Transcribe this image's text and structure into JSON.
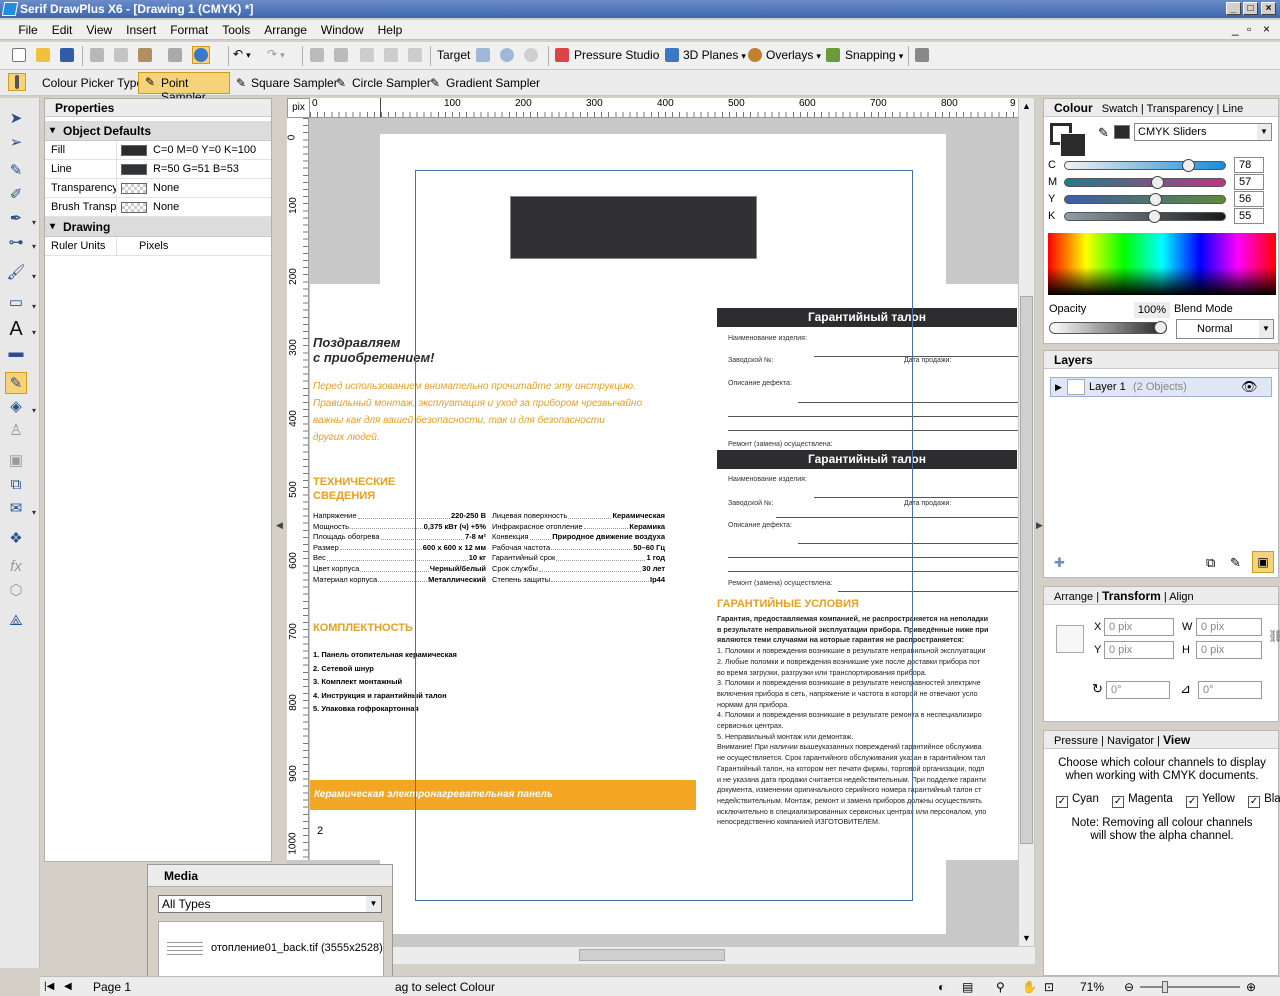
{
  "window": {
    "title": "Serif DrawPlus X6 - [Drawing 1 (CMYK) *]"
  },
  "menu": [
    "File",
    "Edit",
    "View",
    "Insert",
    "Format",
    "Tools",
    "Arrange",
    "Window",
    "Help"
  ],
  "toolbar": {
    "target": "Target",
    "pressure_studio": "Pressure Studio",
    "planes_3d": "3D Planes",
    "overlays": "Overlays",
    "snapping": "Snapping"
  },
  "context": {
    "label": "Colour Picker Type:",
    "point": "Point Sampler",
    "square": "Square Sampler",
    "circle": "Circle Sampler",
    "gradient": "Gradient Sampler"
  },
  "properties": {
    "title": "Properties",
    "object_defaults": "Object Defaults",
    "rows": [
      {
        "k": "Fill",
        "v": "C=0 M=0 Y=0 K=100",
        "swatch": "#2b2b2b"
      },
      {
        "k": "Line",
        "v": "R=50 G=51 B=53",
        "swatch": "#323335"
      },
      {
        "k": "Transparency",
        "v": "None",
        "swatch": "checker"
      },
      {
        "k": "Brush Transparency",
        "v": "None",
        "swatch": "checker"
      }
    ],
    "drawing": "Drawing",
    "ruler": {
      "k": "Ruler Units",
      "v": "Pixels"
    }
  },
  "rulers": {
    "unit": "pix",
    "h": [
      "0",
      "100",
      "200",
      "300",
      "400",
      "500",
      "600",
      "700",
      "800",
      "9"
    ],
    "v": [
      "0",
      "100",
      "200",
      "300",
      "400",
      "500",
      "600",
      "700",
      "800",
      "900",
      "1000"
    ]
  },
  "doc": {
    "page_number": "2",
    "congrats1": "Поздравляем",
    "congrats2": "с приобретением!",
    "intro": [
      "Перед использованием внимательно прочитайте эту инструкцию.",
      "Правильный монтаж, эксплуатация и уход за прибором чрезвычайно",
      "важны как для вашей безопасности, так и для безопасности",
      "других людей."
    ],
    "tech_title1": "ТЕХНИЧЕСКИЕ",
    "tech_title2": "СВЕДЕНИЯ",
    "specs_left": [
      [
        "Напряжение",
        "220-250 В"
      ],
      [
        "Мощность",
        "0,375 кВт (ч) +5%"
      ],
      [
        "Площадь обогрева",
        "7-8 м²"
      ],
      [
        "Размер",
        "600 х 600 х 12 мм"
      ],
      [
        "Вес",
        "10 кг"
      ],
      [
        "Цвет корпуса",
        "Черный/белый"
      ],
      [
        "Материал корпуса",
        "Металлический"
      ]
    ],
    "specs_right": [
      [
        "Лицевая поверхность",
        "Керамическая"
      ],
      [
        "Инфракрасное отопление",
        "Керамика"
      ],
      [
        "Конвекция",
        "Природное движение воздуха"
      ],
      [
        "Рабочая частота",
        "50–60 Гц"
      ],
      [
        "Гарантийный срок",
        "1 год"
      ],
      [
        "Срок службы",
        "30 лет"
      ],
      [
        "Степень защиты",
        "Ip44"
      ]
    ],
    "kit_title": "КОМПЛЕКТНОСТЬ",
    "kit_items": [
      "1. Панель отопительная керамическая",
      "2. Сетевой шнур",
      "3. Комплект монтажный",
      "4. Инструкция и гарантийный талон",
      "5. Упаковка гофрокартонная"
    ],
    "banner": "Керамическая электронагревательная панель",
    "coupon_title": "Гарантийный талон",
    "coupon_fields": {
      "name": "Наименование изделия:",
      "serial": "Заводской №:",
      "date": "Дата продажи:",
      "defect": "Описание дефекта:",
      "repair": "Ремонт (замена) осуществлена:"
    },
    "warranty_title": "ГАРАНТИЙНЫЕ УСЛОВИЯ",
    "warranty_lines": [
      "Гарантия, предоставляемая компанией, не распространяется на неполадки",
      "в результате неправильной эксплуатации прибора. Приведённые ниже при",
      "являются теми случаями на которые гарантия не распространяется:",
      "1. Поломки и повреждения возникшие в результате неправильной эксплуатации",
      "2. Любые поломки и повреждения возникшие уже после доставки прибора пот",
      "во время загрузки, разгрузки или транспортирования прибора.",
      "3. Поломки и повреждения возникшие в результате неисправностей электриче",
      "включения прибора в сеть, напряжение и частота в которой не отвечают усло",
      "нормам для прибора.",
      "4. Поломки и повреждения возникшие в результате ремонта в неспециализиро",
      "сервисных центрах.",
      "5. Неправильный монтаж или демонтаж.",
      "Внимание! При наличии вышеуказанных повреждений гарантийное обслужива",
      "не осуществляется. Срок гарантийного обслуживания указан в гарантийном тал",
      "Гарантийный талон, на котором нет печати фирмы, торговой организации, подп",
      "и не указана дата продажи считается недействительным. При подделке гаранти",
      "документа, изменении оригинального серийного номера гарантийный талон ст",
      "недействительным. Монтаж, ремонт и замена приборов должны осуществлять",
      "исключительно в специализированных сервисных центрах или персоналом, упо",
      "непосредственно компанией ИЗГОТОВИТЕЛЕМ."
    ]
  },
  "colour_panel": {
    "tabs": [
      "Colour",
      "Swatch",
      "Transparency",
      "Line"
    ],
    "mode": "CMYK Sliders",
    "channels": [
      {
        "k": "C",
        "v": "78",
        "pct": 0.78,
        "c1": "#f2f2f2",
        "c2": "#1b8ad6"
      },
      {
        "k": "M",
        "v": "57",
        "pct": 0.57,
        "c1": "#1e7e8a",
        "c2": "#c0357e"
      },
      {
        "k": "Y",
        "v": "56",
        "pct": 0.56,
        "c1": "#3a5ea6",
        "c2": "#5e8a3a"
      },
      {
        "k": "K",
        "v": "55",
        "pct": 0.55,
        "c1": "#8fa0a8",
        "c2": "#1a1a1a"
      }
    ],
    "opacity_label": "Opacity",
    "opacity": "100%",
    "blend_label": "Blend Mode",
    "blend": "Normal"
  },
  "layers": {
    "title": "Layers",
    "name": "Layer 1",
    "count": "(2 Objects)"
  },
  "transform": {
    "tabs": [
      "Arrange",
      "Transform",
      "Align"
    ],
    "x_label": "X",
    "y_label": "Y",
    "w_label": "W",
    "h_label": "H",
    "x": "0 pix",
    "y": "0 pix",
    "w": "0 pix",
    "h": "0 pix",
    "rot": "0°",
    "shear": "0°"
  },
  "view_panel": {
    "tabs": [
      "Pressure",
      "Navigator",
      "View"
    ],
    "desc": "Choose which colour channels to display when working with CMYK documents.",
    "channels": [
      "Cyan",
      "Magenta",
      "Yellow",
      "Black"
    ],
    "note": "Note: Removing all colour channels will show the alpha channel."
  },
  "media": {
    "title": "Media",
    "filter": "All Types",
    "file": "отопление01_back.tif (3555x2528)"
  },
  "status": {
    "page": "Page 1",
    "hint": "ag to select Colour",
    "zoom": "71%"
  }
}
